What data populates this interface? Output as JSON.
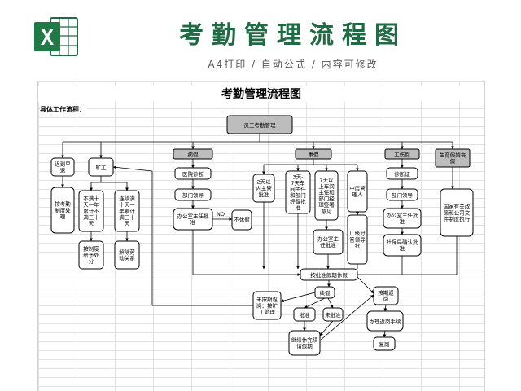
{
  "banner": {
    "title": "考勤管理流程图",
    "subtitle": "A4打印 / 自动公式 / 内容可修改",
    "icon_name": "excel-icon",
    "title_color": "#1f6b44"
  },
  "sheet": {
    "title": "考勤管理流程图",
    "section_label": "具体工作流程："
  },
  "nodes": {
    "root": "员工考勤管理",
    "cat1": "迟到早退",
    "cat2": "旷工",
    "cat3": "病假",
    "cat4": "事假",
    "cat5": "工伤假",
    "cat6": "生育假婚丧假",
    "n_late_rule": "按考勤制度处理",
    "n_abs_a": "不满十天一年累计不满三十天",
    "n_abs_b": "连续满十天一年累计满三十天",
    "n_abs_a2": "按制度给予处分",
    "n_abs_b2": "解除劳动关系",
    "n_sick1": "医院诊断",
    "n_sick2": "部门领导",
    "n_sick3": "办公室主任批准",
    "n_sick_no": "不休假",
    "n_personal1": "2天以内主管批准",
    "n_personal2": "3天-7天车间主任和部门经理批准",
    "n_personal3": "7天以上车间主任和部门经理签署意见",
    "n_personal4": "中层管理人",
    "n_personal5": "办公室主任批准",
    "n_personal6": "厂级分管领导批",
    "n_injury1": "诊断证",
    "n_injury2": "部门领导",
    "n_injury3": "办公室主任批准",
    "n_injury4": "社保局确认批准",
    "n_maternity1": "国家有关政策和公司文件制度执行",
    "n_leave_approved": "按批准假期休假",
    "n_late_return": "未按期返岗：按旷工处理",
    "n_renew": "续假",
    "n_ontime": "按期返岗",
    "n_approve": "批准",
    "n_reject": "未批准",
    "n_finish": "办理返岗手续",
    "n_reapply": "继续休完续请假期",
    "n_work": "复岗",
    "edge_no": "NO"
  }
}
